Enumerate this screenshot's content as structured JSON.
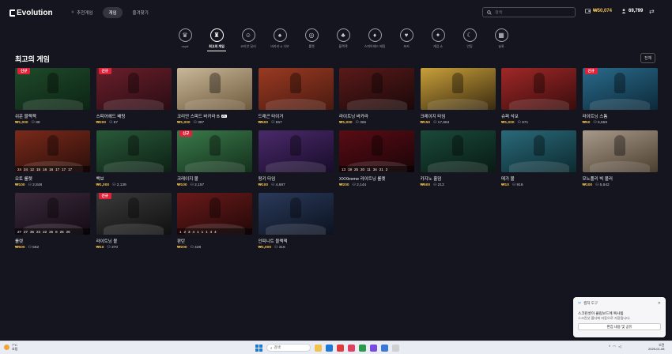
{
  "header": {
    "logo_text": "Evolution",
    "nav": [
      {
        "label": "추천게임",
        "active": false
      },
      {
        "label": "게임",
        "active": true
      },
      {
        "label": "즐겨찾기",
        "active": false
      }
    ],
    "search_placeholder": "검색",
    "balance": "₩50,074",
    "players": "69,799"
  },
  "categories": [
    {
      "label": "royal",
      "icon": "crown-icon",
      "glyph": "♛"
    },
    {
      "label": "최고의 게임",
      "icon": "trophy-icon",
      "glyph": "♜",
      "active": true
    },
    {
      "label": "코리안 딜러",
      "icon": "dealer-icon",
      "glyph": "☺"
    },
    {
      "label": "바카라 & 식보",
      "icon": "cards-icon",
      "glyph": "♠"
    },
    {
      "label": "룰렛",
      "icon": "roulette-icon",
      "glyph": "◎"
    },
    {
      "label": "블랙잭",
      "icon": "blackjack-icon",
      "glyph": "♣"
    },
    {
      "label": "스피어헤드 배팅",
      "icon": "chips-icon",
      "glyph": "♦"
    },
    {
      "label": "포커",
      "icon": "poker-icon",
      "glyph": "♥"
    },
    {
      "label": "게임 쇼",
      "icon": "wand-icon",
      "glyph": "✦"
    },
    {
      "label": "인팅",
      "icon": "moon-icon",
      "glyph": "☾"
    },
    {
      "label": "슬롯",
      "icon": "slot-icon",
      "glyph": "▦"
    }
  ],
  "section": {
    "title": "최고의 게임",
    "all_label": "전체"
  },
  "games": [
    {
      "name": "쉬운 블랙잭",
      "min": "₩1,000",
      "players": "88",
      "badge": "신규",
      "color1": "#1f4a2a",
      "color2": "#0c2414"
    },
    {
      "name": "스피어헤드 배팅",
      "min": "₩200",
      "players": "87",
      "badge": "신규",
      "color1": "#6a1f2a",
      "color2": "#2a0c14"
    },
    {
      "name": "코리안 스피드 바카라 B",
      "min": "₩1,000",
      "players": "387",
      "badge": "",
      "tag": "ZK",
      "color1": "#c9b79a",
      "color2": "#6e5a3c",
      "nums": [
        "",
        "",
        ""
      ]
    },
    {
      "name": "드래곤 타이거",
      "min": "₩500",
      "players": "557",
      "badge": "",
      "color1": "#9a3a22",
      "color2": "#4a1a10"
    },
    {
      "name": "라이트닝 바카라",
      "min": "₩1,000",
      "players": "365",
      "badge": "",
      "color1": "#5a1a1a",
      "color2": "#1a0808"
    },
    {
      "name": "크레이지 타임",
      "min": "₩150",
      "players": "17,684",
      "badge": "",
      "color1": "#c8a03a",
      "color2": "#3a2a10"
    },
    {
      "name": "슈퍼 식보",
      "min": "₩1,000",
      "players": "671",
      "badge": "",
      "color1": "#a02828",
      "color2": "#3a0c0c"
    },
    {
      "name": "라이트닝 스톰",
      "min": "₩50",
      "players": "5,559",
      "badge": "신규",
      "color1": "#2a6a8a",
      "color2": "#0c2a3a"
    },
    {
      "name": "오토 룰렛",
      "min": "₩100",
      "players": "2,848",
      "badge": "",
      "color1": "#7a2a1a",
      "color2": "#2a0e0a",
      "nums": [
        "24",
        "24",
        "12",
        "15",
        "16",
        "16",
        "17",
        "17",
        "17"
      ]
    },
    {
      "name": "백보",
      "min": "₩1,000",
      "players": "2,139",
      "badge": "",
      "color1": "#2a5a3a",
      "color2": "#0c2014"
    },
    {
      "name": "크레이지 볼",
      "min": "₩100",
      "players": "2,157",
      "badge": "신규",
      "color1": "#3a7a4a",
      "color2": "#14301c"
    },
    {
      "name": "펑키 타임",
      "min": "₩100",
      "players": "4,687",
      "badge": "",
      "color1": "#4a2a6a",
      "color2": "#180c2a"
    },
    {
      "name": "XXXtreme 라이트닝 룰렛",
      "min": "₩200",
      "players": "2,144",
      "badge": "",
      "color1": "#5a0c14",
      "color2": "#1a0408",
      "nums": [
        "13",
        "19",
        "25",
        "20",
        "11",
        "34",
        "21",
        "2"
      ]
    },
    {
      "name": "카지노 홀덤",
      "min": "₩500",
      "players": "213",
      "badge": "",
      "color1": "#1a4a3a",
      "color2": "#081a14"
    },
    {
      "name": "메가 볼",
      "min": "₩10",
      "players": "916",
      "badge": "",
      "color1": "#2a6a7a",
      "color2": "#0c2a30"
    },
    {
      "name": "모노폴리 빅 볼러",
      "min": "₩100",
      "players": "5,642",
      "badge": "",
      "color1": "#a89a8a",
      "color2": "#4a3e30"
    },
    {
      "name": "룰렛",
      "min": "₩500",
      "players": "562",
      "badge": "",
      "color1": "#3a2a3a",
      "color2": "#140a14",
      "nums": [
        "27",
        "27",
        "35",
        "23",
        "22",
        "25",
        "8",
        "26",
        "26"
      ]
    },
    {
      "name": "라이트닝 볼",
      "min": "₩10",
      "players": "370",
      "badge": "신규",
      "color1": "#3a3a3a",
      "color2": "#101010"
    },
    {
      "name": "판탄",
      "min": "₩200",
      "players": "428",
      "badge": "",
      "color1": "#6a1a1a",
      "color2": "#220808",
      "nums": [
        "1",
        "2",
        "3",
        "4",
        "1",
        "1",
        "1",
        "4",
        "4"
      ]
    },
    {
      "name": "인피니트 블랙잭",
      "min": "₩1,000",
      "players": "316",
      "badge": "",
      "color1": "#2a3a5a",
      "color2": "#0c1220"
    }
  ],
  "notification": {
    "app": "캡처 도구",
    "message": "스크린샷이 클립보드에 복사됨",
    "sub": "스크린샷 폴더에 자동으로 저장됩니다.",
    "button": "편집 내용 및 공유"
  },
  "taskbar": {
    "weather_temp": "7°C",
    "weather_desc": "흐림",
    "search_label": "검색",
    "time": "오전",
    "date": "2025-01-08",
    "apps": [
      "#f2c14e",
      "#1e78d6",
      "#e03a3a",
      "#e04060",
      "#2a9a4a",
      "#7a4ae0",
      "#3a7ad6",
      "#d0d0d0"
    ]
  }
}
